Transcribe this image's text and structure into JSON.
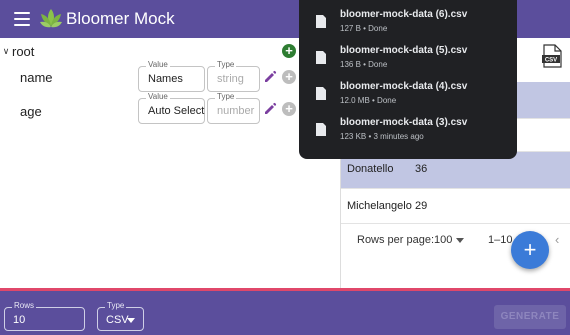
{
  "app": {
    "title": "Bloomer Mock",
    "accent_color": "#5b4e9c",
    "menu_icon": "hamburger-menu-icon",
    "logo_icon": "lotus-logo-icon"
  },
  "schema": {
    "root_label": "root",
    "fields": [
      {
        "name": "name",
        "value_label": "Value",
        "value": "Names",
        "type_label": "Type",
        "type_placeholder": "string"
      },
      {
        "name": "age",
        "value_label": "Value",
        "value": "Auto Select",
        "type_label": "Type",
        "type_placeholder": "number"
      }
    ]
  },
  "preview": {
    "rows": [
      {
        "name": "Donatello",
        "age": "36",
        "highlighted": true
      },
      {
        "name": "Michelangelo",
        "age": "29",
        "highlighted": false
      }
    ],
    "pagination": {
      "rows_per_page_label": "Rows per page:",
      "rows_per_page": "100",
      "range": "1–10"
    },
    "fab_label": "+"
  },
  "bottom": {
    "rows_label": "Rows",
    "rows_value": "10",
    "type_label": "Type",
    "type_value": "CSV",
    "generate_label": "GENERATE"
  },
  "downloads": [
    {
      "filename": "bloomer-mock-data (6).csv",
      "status": "127 B • Done"
    },
    {
      "filename": "bloomer-mock-data (5).csv",
      "status": "136 B • Done"
    },
    {
      "filename": "bloomer-mock-data (4).csv",
      "status": "12.0 MB • Done"
    },
    {
      "filename": "bloomer-mock-data (3).csv",
      "status": "123 KB • 3 minutes ago"
    }
  ]
}
